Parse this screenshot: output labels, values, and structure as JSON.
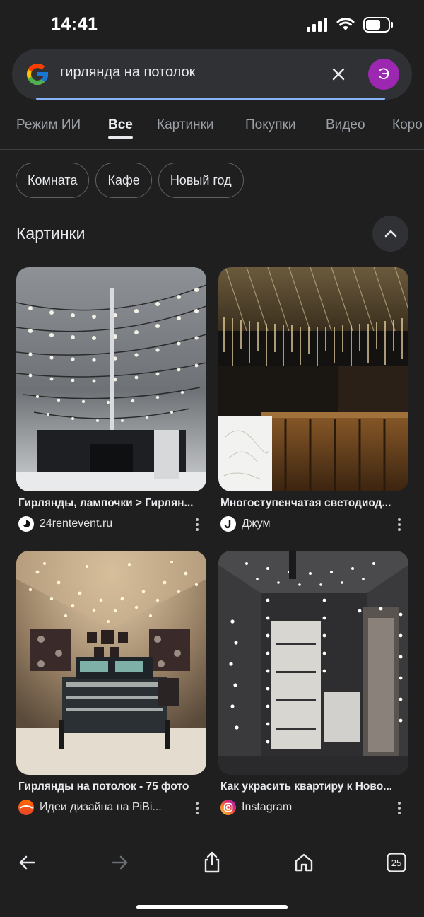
{
  "status": {
    "time": "14:41"
  },
  "search": {
    "query": "гирлянда на потолок",
    "avatar_letter": "Э"
  },
  "tabs": [
    {
      "label": "Режим ИИ",
      "active": false
    },
    {
      "label": "Все",
      "active": true
    },
    {
      "label": "Картинки",
      "active": false
    },
    {
      "label": "Покупки",
      "active": false
    },
    {
      "label": "Видео",
      "active": false
    },
    {
      "label": "Коро",
      "active": false
    }
  ],
  "chips": [
    "Комната",
    "Кафе",
    "Новый год"
  ],
  "section": {
    "title": "Картинки"
  },
  "results": [
    {
      "title": "Гирлянды, лампочки > Гирлян...",
      "source": "24rentevent.ru",
      "icon": "24rentevent-icon"
    },
    {
      "title": "Многоступенчатая светодиод...",
      "source": "Джум",
      "icon": "joom-icon"
    },
    {
      "title": "Гирлянды на потолок - 75 фото",
      "source": "Идеи дизайна на PiBi...",
      "icon": "pibi-icon"
    },
    {
      "title": "Как украсить квартиру к Ново...",
      "source": "Instagram",
      "icon": "instagram-icon"
    }
  ],
  "bottom_nav": {
    "tab_count": "25"
  },
  "colors": {
    "background": "#1f1f1f",
    "search_bg": "#303134",
    "avatar": "#9c27b0",
    "accent": "#8ab4f8"
  }
}
